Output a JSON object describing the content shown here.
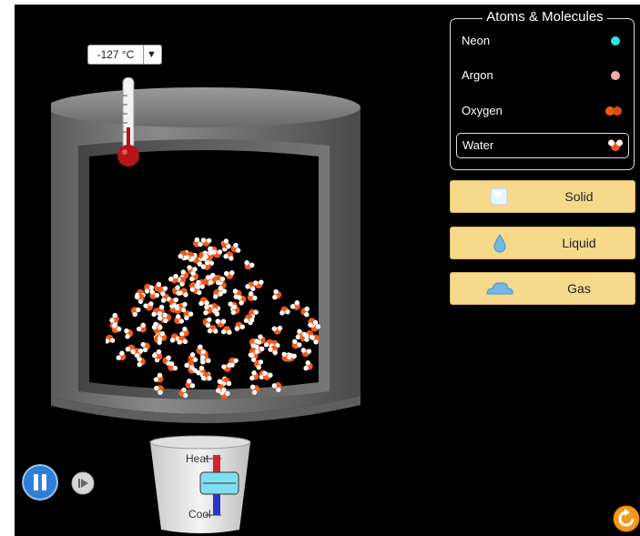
{
  "temperature": {
    "readout": "-127 °C",
    "units_dropdown_icon": "▼"
  },
  "species_panel": {
    "title": "Atoms & Molecules",
    "items": [
      {
        "label": "Neon",
        "color": "#2ee6e6",
        "icon": "neon-atom-icon"
      },
      {
        "label": "Argon",
        "color": "#f8a8a8",
        "icon": "argon-atom-icon"
      },
      {
        "label": "Oxygen",
        "color": "#f25a1a",
        "icon": "oxygen-molecule-icon"
      },
      {
        "label": "Water",
        "color": "#ffffff",
        "icon": "water-molecule-icon",
        "selected": true
      }
    ]
  },
  "phase_buttons": [
    {
      "label": "Solid",
      "icon": "ice-cube-icon"
    },
    {
      "label": "Liquid",
      "icon": "water-drop-icon"
    },
    {
      "label": "Gas",
      "icon": "cloud-icon"
    }
  ],
  "heat_control": {
    "heat_label": "Heat",
    "cool_label": "Cool"
  },
  "controls": {
    "pause_icon": "pause-icon",
    "step_icon": "step-forward-icon",
    "reset_icon": "reset-icon"
  },
  "colors": {
    "button_bg": "#f7d98c",
    "oxygen": "#f25a1a",
    "hydrogen": "#ffffff",
    "thermometer_bulb": "#b3161a",
    "pause_blue": "#2f7fd8",
    "reset_orange": "#f39a1d"
  }
}
